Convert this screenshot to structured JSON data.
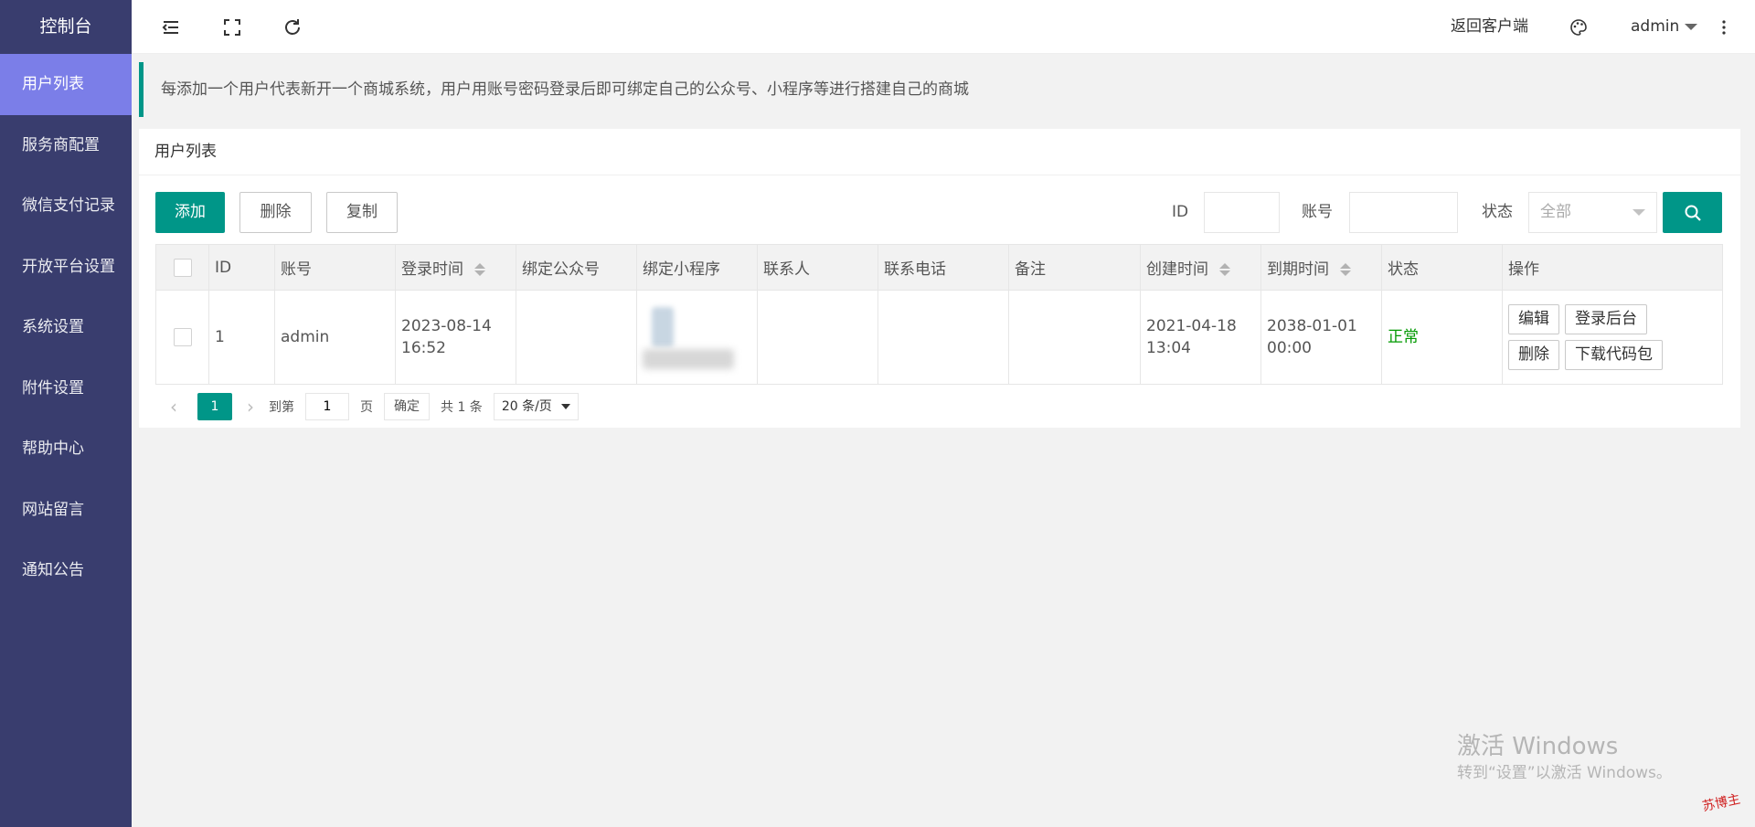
{
  "sidebar": {
    "logo": "控制台",
    "items": [
      {
        "label": "用户列表"
      },
      {
        "label": "服务商配置"
      },
      {
        "label": "微信支付记录"
      },
      {
        "label": "开放平台设置"
      },
      {
        "label": "系统设置"
      },
      {
        "label": "附件设置"
      },
      {
        "label": "帮助中心"
      },
      {
        "label": "网站留言"
      },
      {
        "label": "通知公告"
      }
    ]
  },
  "header": {
    "back_to_client": "返回客户端",
    "user": "admin"
  },
  "tip": "每添加一个用户代表新开一个商城系统，用户用账号密码登录后即可绑定自己的公众号、小程序等进行搭建自己的商城",
  "card": {
    "title": "用户列表"
  },
  "toolbar": {
    "add_label": "添加",
    "delete_label": "删除",
    "copy_label": "复制"
  },
  "filters": {
    "id_label": "ID",
    "id_value": "",
    "account_label": "账号",
    "account_value": "",
    "status_label": "状态",
    "status_value": "全部"
  },
  "table": {
    "columns": [
      "ID",
      "账号",
      "登录时间",
      "绑定公众号",
      "绑定小程序",
      "联系人",
      "联系电话",
      "备注",
      "创建时间",
      "到期时间",
      "状态",
      "操作"
    ],
    "rows": [
      {
        "id": "1",
        "account": "admin",
        "login_time": "2023-08-14 16:52",
        "official_account": "",
        "contact": "",
        "phone": "",
        "remark": "",
        "created": "2021-04-18 13:04",
        "expire": "2038-01-01 00:00",
        "status": "正常",
        "actions": {
          "edit": "编辑",
          "login_backend": "登录后台",
          "delete": "删除",
          "download_code": "下载代码包"
        }
      }
    ]
  },
  "pager": {
    "current": "1",
    "goto_label": "到第",
    "goto_value": "1",
    "page_unit": "页",
    "confirm": "确定",
    "total": "共 1 条",
    "page_size": "20 条/页"
  },
  "watermark": {
    "line1": "激活 Windows",
    "line2": "转到“设置”以激活 Windows。"
  },
  "stamp": "苏博主"
}
